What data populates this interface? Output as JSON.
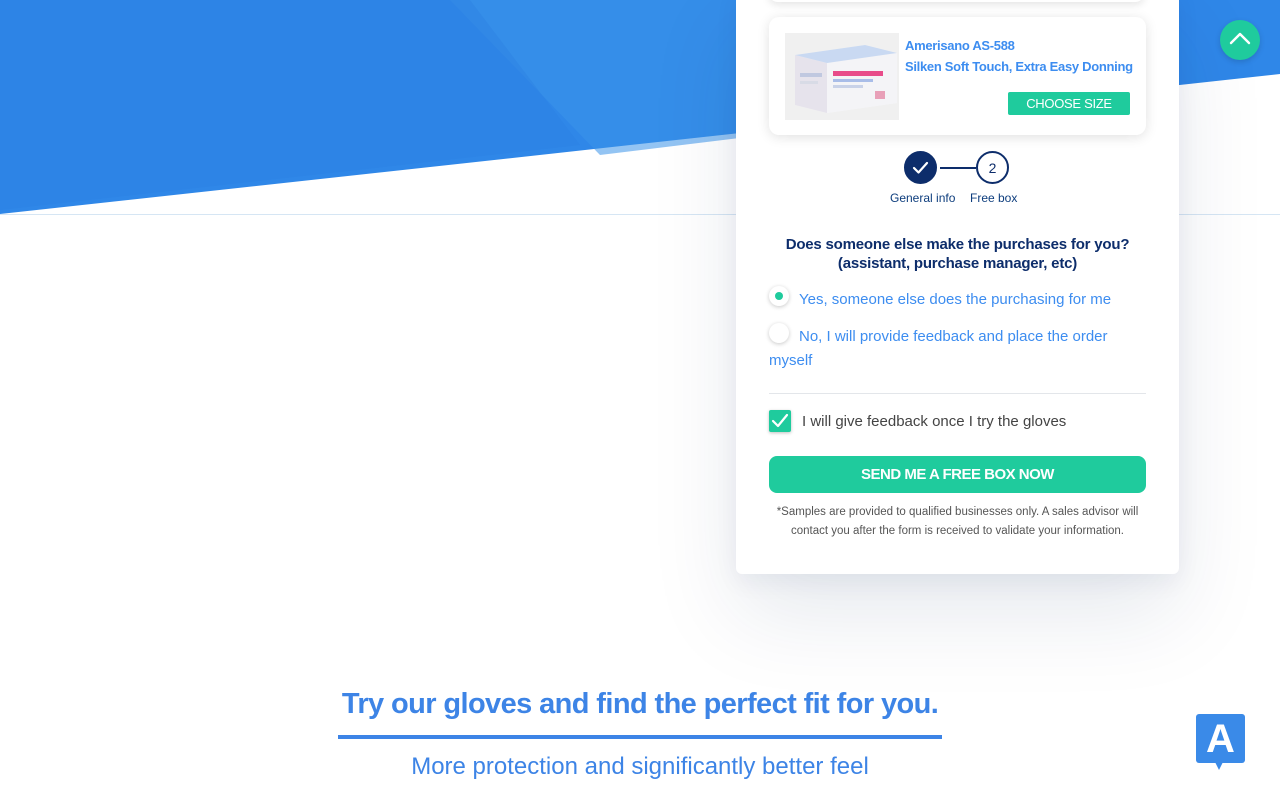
{
  "colors": {
    "hero_blue": "#2f87e8",
    "accent_green": "#1fcb9d",
    "navy": "#0d2d6b",
    "link_blue": "#3d8df0"
  },
  "product": {
    "name": "Amerisano AS-588",
    "description": "Silken Soft Touch, Extra Easy Donning",
    "button_label": "CHOOSE SIZE",
    "image_icon": "nitrile-gloves-box-image"
  },
  "steps": [
    {
      "label": "General info",
      "state": "completed"
    },
    {
      "label": "Free box",
      "number": "2",
      "state": "current"
    }
  ],
  "form": {
    "question_line1": "Does someone else make the purchases for you?",
    "question_line2": "(assistant, purchase manager, etc)",
    "options": [
      {
        "label": "Yes, someone else does the purchasing for me",
        "selected": true
      },
      {
        "label": "No, I will provide feedback and place the order myself",
        "selected": false
      }
    ],
    "feedback_checkbox": {
      "label": "I will give feedback once I try the gloves",
      "checked": true
    },
    "submit_label": "SEND ME A FREE BOX NOW",
    "disclaimer": "*Samples are provided to qualified businesses only. A sales advisor will contact you after the form is received to validate your information."
  },
  "section": {
    "title": "Try our gloves and find the perfect fit for you.",
    "subtitle": "More protection and significantly better feel"
  },
  "widgets": {
    "scroll_top_icon": "chevron-up-icon",
    "chat_letter": "A"
  }
}
